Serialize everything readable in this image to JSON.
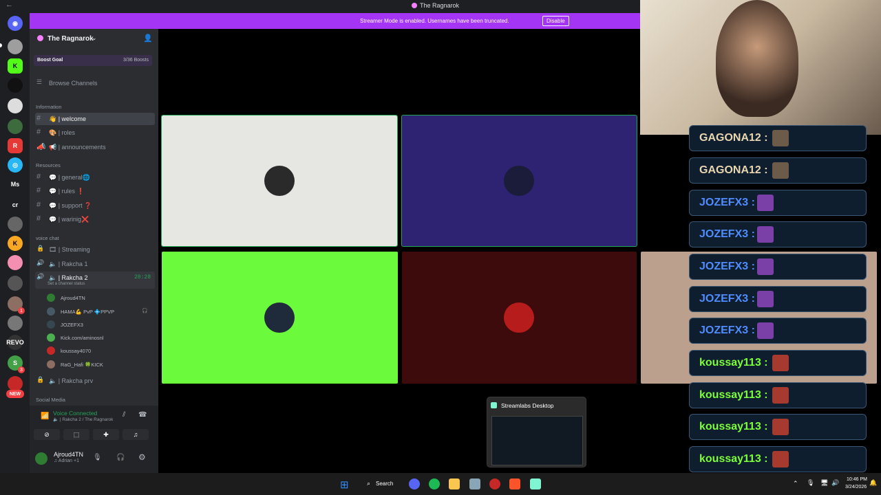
{
  "window": {
    "title": "The Ragnarok"
  },
  "banner": {
    "text": "Streamer Mode is enabled. Usernames have been truncated.",
    "disable_label": "Disable"
  },
  "server": {
    "name": "The Ragnarok",
    "boost_goal": "Boost Goal",
    "boost_count": "3/36 Boosts"
  },
  "sidebar": {
    "browse": "Browse Channels",
    "categories": {
      "information": "Information",
      "resources": "Resources",
      "voice_chat": "voice chat",
      "social_media": "Social Media"
    },
    "info_channels": [
      {
        "name": "👋 | welcome"
      },
      {
        "name": "🎨 | roles"
      },
      {
        "name": "📢 | announcements"
      }
    ],
    "resource_channels": [
      {
        "name": "💬 | general🌐"
      },
      {
        "name": "💬 | rules ❗"
      },
      {
        "name": "💬 | support ❓"
      },
      {
        "name": "💬 | warinig❌"
      }
    ],
    "voice_channels": [
      {
        "name": "🎞 | Streaming"
      },
      {
        "name": "🔈 | Rakcha 1"
      },
      {
        "name": "🔈 | Rakcha 2",
        "status": "Set a channel status",
        "timer": "28:28"
      }
    ],
    "members": [
      {
        "name": "Ajroud4TN",
        "color": "#2e7d32"
      },
      {
        "name": "HAMA💪 PvP 💠PPVP",
        "color": "#455a64"
      },
      {
        "name": "JOZEFX3",
        "color": "#37474f"
      },
      {
        "name": "Kick.com/aminosnl",
        "color": "#4caf50"
      },
      {
        "name": "koussay4070",
        "color": "#c62828"
      },
      {
        "name": "RaG_Hafi 🍀KICK",
        "color": "#8d6e63"
      }
    ],
    "private_channel": "🔈 | Rakcha prv"
  },
  "voice_panel": {
    "status": "Voice Connected",
    "location": "🔈 | Rakcha 2 / The Ragnarok"
  },
  "user": {
    "name": "Ajroud4TN",
    "activity": "♫ Adrian +1"
  },
  "tiles": [
    {
      "bg": "#e6e7e3",
      "avatar": "#2a2a2a"
    },
    {
      "bg": "#2d2372",
      "avatar": "#1b1b3a"
    },
    {
      "bg": "#6bfa3c",
      "avatar": "#1f2b3a"
    },
    {
      "bg": "#3d0b0b",
      "avatar": "#b71c1c"
    }
  ],
  "chat": [
    {
      "name": "GAGONA12 :",
      "color": "#e8d6b0"
    },
    {
      "name": "GAGONA12 :",
      "color": "#e8d6b0"
    },
    {
      "name": "JOZEFX3 :",
      "color": "#4f8dff"
    },
    {
      "name": "JOZEFX3 :",
      "color": "#4f8dff"
    },
    {
      "name": "JOZEFX3 :",
      "color": "#4f8dff"
    },
    {
      "name": "JOZEFX3 :",
      "color": "#4f8dff"
    },
    {
      "name": "JOZEFX3 :",
      "color": "#4f8dff"
    },
    {
      "name": "koussay113 :",
      "color": "#7cff3a"
    },
    {
      "name": "koussay113 :",
      "color": "#7cff3a"
    },
    {
      "name": "koussay113 :",
      "color": "#7cff3a"
    },
    {
      "name": "koussay113 :",
      "color": "#7cff3a"
    }
  ],
  "popup": {
    "title": "Streamlabs Desktop"
  },
  "taskbar": {
    "search": "Search",
    "time": "10:46 PM",
    "date": "3/24/2026"
  }
}
